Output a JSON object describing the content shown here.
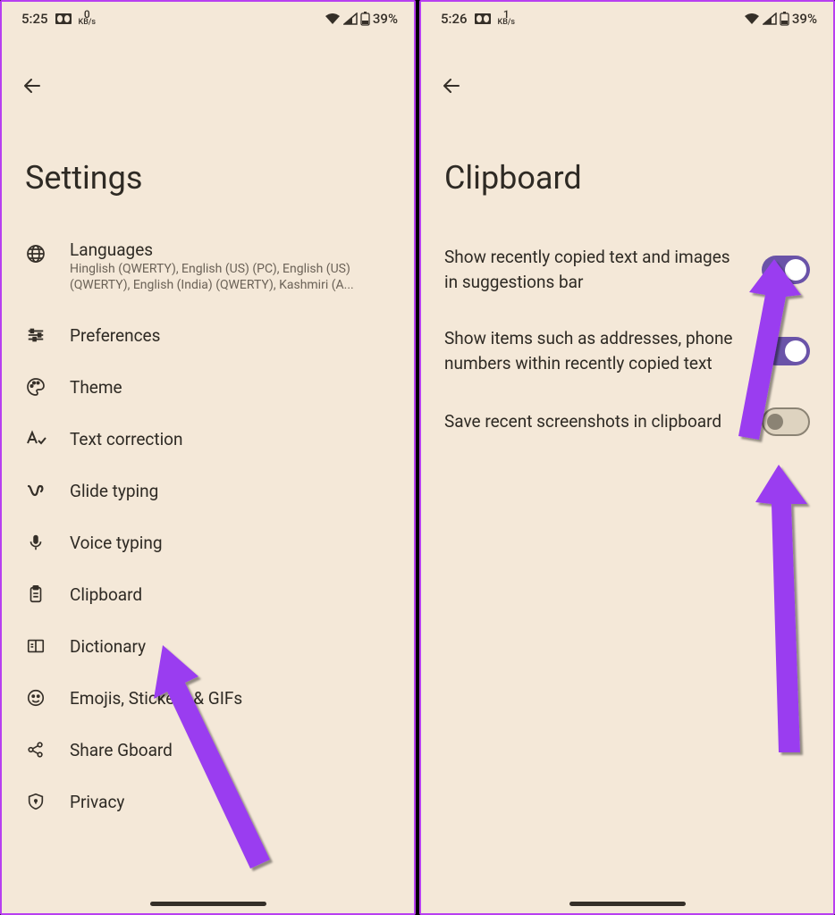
{
  "screen1": {
    "status": {
      "time": "5:25",
      "kbs_top": "0",
      "kbs_bot": "KB/s",
      "battery": "39%"
    },
    "title": "Settings",
    "items": [
      {
        "icon": "globe-icon",
        "label": "Languages",
        "sub": "Hinglish (QWERTY), English (US) (PC), English (US) (QWERTY), English (India) (QWERTY), Kashmiri (A..."
      },
      {
        "icon": "sliders-icon",
        "label": "Preferences"
      },
      {
        "icon": "palette-icon",
        "label": "Theme"
      },
      {
        "icon": "text-correction-icon",
        "label": "Text correction"
      },
      {
        "icon": "glide-icon",
        "label": "Glide typing"
      },
      {
        "icon": "mic-icon",
        "label": "Voice typing"
      },
      {
        "icon": "clipboard-icon",
        "label": "Clipboard"
      },
      {
        "icon": "dictionary-icon",
        "label": "Dictionary"
      },
      {
        "icon": "emoji-icon",
        "label": "Emojis, Stickers & GIFs"
      },
      {
        "icon": "share-icon",
        "label": "Share Gboard"
      },
      {
        "icon": "shield-icon",
        "label": "Privacy"
      }
    ]
  },
  "screen2": {
    "status": {
      "time": "5:26",
      "kbs_top": "1",
      "kbs_bot": "KB/s",
      "battery": "39%"
    },
    "title": "Clipboard",
    "items": [
      {
        "label": "Show recently copied text and images in suggestions bar",
        "on": true
      },
      {
        "label": "Show items such as addresses, phone numbers within recently copied text",
        "on": true
      },
      {
        "label": "Save recent screenshots in clipboard",
        "on": false
      }
    ]
  },
  "colors": {
    "arrow": "#9a3cf0"
  }
}
